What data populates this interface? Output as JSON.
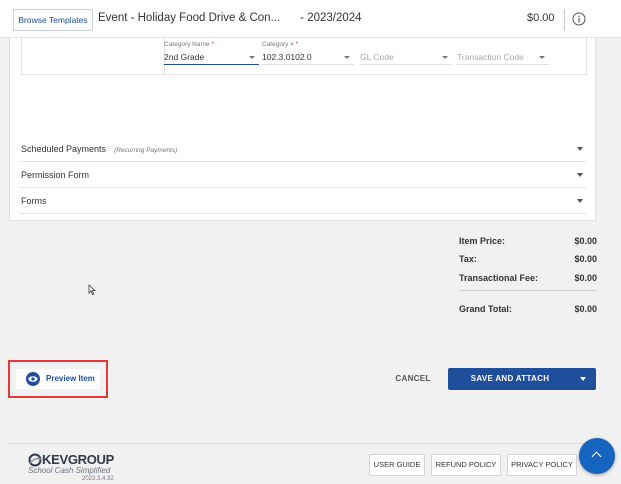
{
  "header": {
    "browse_templates": "Browse Templates",
    "title": "Event - Holiday Food Drive & Con...",
    "year": "- 2023/2024",
    "price": "$0.00",
    "info_icon": "info-icon"
  },
  "fields": {
    "category_name": {
      "label": "Category Name",
      "required_mark": "*",
      "value": "2nd Grade"
    },
    "category_number": {
      "label": "Category #",
      "required_mark": "*",
      "value": "102.3.0102.0"
    },
    "gl_code": {
      "placeholder": "GL Code"
    },
    "transaction_code": {
      "placeholder": "Transaction Code"
    }
  },
  "sections": {
    "scheduled_payments": {
      "label": "Scheduled Payments",
      "sub": "(Recurring Payments)"
    },
    "permission_form": {
      "label": "Permission Form"
    },
    "forms": {
      "label": "Forms"
    }
  },
  "totals": {
    "item_price": {
      "label": "Item Price:",
      "value": "$0.00"
    },
    "tax": {
      "label": "Tax:",
      "value": "$0.00"
    },
    "transactional_fee": {
      "label": "Transactional Fee:",
      "value": "$0.00"
    },
    "grand_total": {
      "label": "Grand Total:",
      "value": "$0.00"
    }
  },
  "actions": {
    "preview": "Preview Item",
    "cancel": "CANCEL",
    "save_attach": "SAVE AND ATTACH"
  },
  "footer": {
    "logo_word": "KEVGROUP",
    "logo_tagline": "School Cash Simplified",
    "version": "2023.3.4.32",
    "user_guide": "USER GUIDE",
    "refund_policy": "REFUND POLICY",
    "privacy_policy": "PRIVACY POLICY"
  },
  "colors": {
    "primary": "#1f4e9b",
    "highlight_box": "#e53935",
    "fab": "#1565c0"
  }
}
